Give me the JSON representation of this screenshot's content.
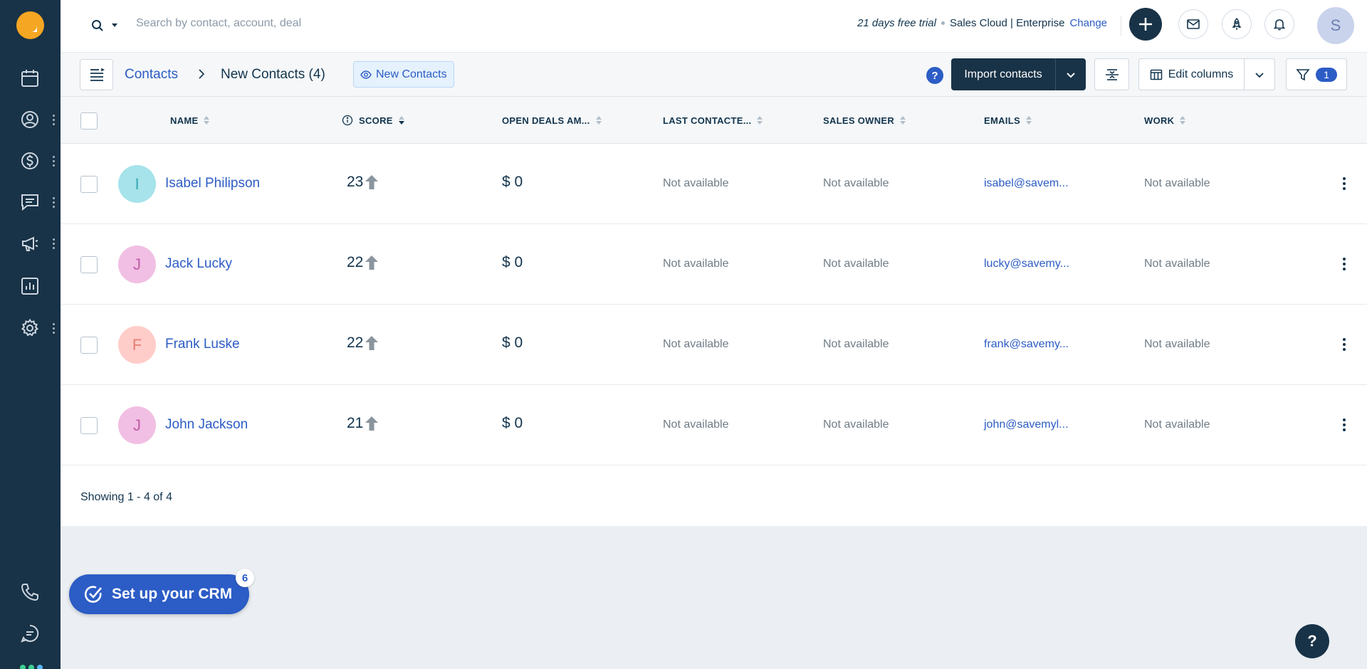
{
  "search": {
    "placeholder": "Search by contact, account, deal"
  },
  "trial": {
    "days_text": "21 days free trial",
    "plan": "Sales Cloud | Enterprise",
    "change_label": "Change"
  },
  "user": {
    "initial": "S"
  },
  "breadcrumb": {
    "parent": "Contacts",
    "current": "New Contacts (4)"
  },
  "view": {
    "label": "New Contacts"
  },
  "toolbar": {
    "help": "?",
    "import_label": "Import contacts",
    "edit_columns_label": "Edit columns",
    "filter_count": "1"
  },
  "columns": [
    "NAME",
    "SCORE",
    "OPEN DEALS AM...",
    "LAST CONTACTE...",
    "SALES OWNER",
    "EMAILS",
    "WORK"
  ],
  "rows": [
    {
      "initial": "I",
      "name": "Isabel Philipson",
      "score": "23",
      "deal": "$ 0",
      "last_contacted": "Not available",
      "sales_owner": "Not available",
      "email": "isabel@savem...",
      "work": "Not available",
      "avatar_bg": "#a6e3ea",
      "avatar_fg": "#3aa8b5"
    },
    {
      "initial": "J",
      "name": "Jack Lucky",
      "score": "22",
      "deal": "$ 0",
      "last_contacted": "Not available",
      "sales_owner": "Not available",
      "email": "lucky@savemy...",
      "work": "Not available",
      "avatar_bg": "#f1bfe3",
      "avatar_fg": "#c15da8"
    },
    {
      "initial": "F",
      "name": "Frank Luske",
      "score": "22",
      "deal": "$ 0",
      "last_contacted": "Not available",
      "sales_owner": "Not available",
      "email": "frank@savemy...",
      "work": "Not available",
      "avatar_bg": "#ffcdc9",
      "avatar_fg": "#e77e73"
    },
    {
      "initial": "J",
      "name": "John Jackson",
      "score": "21",
      "deal": "$ 0",
      "last_contacted": "Not available",
      "sales_owner": "Not available",
      "email": "john@savemyl...",
      "work": "Not available",
      "avatar_bg": "#f1bfe3",
      "avatar_fg": "#c15da8"
    }
  ],
  "pagination": {
    "text": "Showing 1 - 4 of 4"
  },
  "setup": {
    "label": "Set up your CRM",
    "badge": "6"
  },
  "help_fab": "?",
  "colors": {
    "sidebar": "#183247",
    "accent": "#2c5cc5",
    "brand": "#f5a623"
  },
  "icons": {
    "sidebar": [
      "calendar-icon",
      "contacts-icon",
      "deals-icon",
      "conversations-icon",
      "campaigns-icon",
      "reports-icon",
      "settings-icon",
      "phone-icon",
      "chat-icon"
    ],
    "topbar": [
      "search-icon",
      "plus-icon",
      "mail-icon",
      "rocket-icon",
      "bell-icon"
    ]
  }
}
